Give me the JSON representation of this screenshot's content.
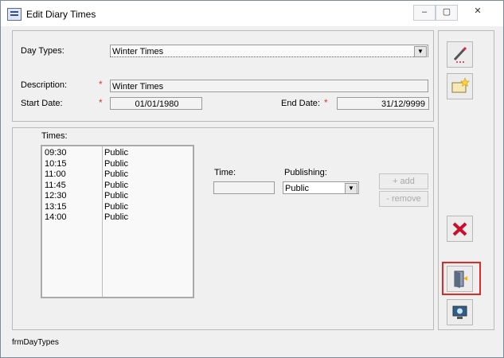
{
  "window": {
    "title": "Edit Diary Times",
    "controls": [
      "–",
      "▢",
      "✕"
    ]
  },
  "form": {
    "day_types_label": "Day Types:",
    "day_types_value": "Winter Times",
    "description_label": "Description:",
    "description_value": "Winter Times",
    "start_date_label": "Start Date:",
    "start_date_value": "01/01/1980",
    "end_date_label": "End Date:",
    "end_date_value": "31/12/9999",
    "required_mark": "*"
  },
  "times": {
    "label": "Times:",
    "rows": [
      {
        "time": "09:30",
        "pub": "Public"
      },
      {
        "time": "10:15",
        "pub": "Public"
      },
      {
        "time": "11:00",
        "pub": "Public"
      },
      {
        "time": "11:45",
        "pub": "Public"
      },
      {
        "time": "12:30",
        "pub": "Public"
      },
      {
        "time": "13:15",
        "pub": "Public"
      },
      {
        "time": "14:00",
        "pub": "Public"
      }
    ],
    "time_label": "Time:",
    "time_value": "",
    "publishing_label": "Publishing:",
    "publishing_value": "Public",
    "add_label": "+ add",
    "remove_label": "- remove"
  },
  "sidebar": {
    "edit_icon": "pencil-icon",
    "new_icon": "new-record-icon",
    "delete_icon": "delete-x-icon",
    "exit_icon": "exit-door-icon",
    "help_icon": "help-monitor-icon",
    "accent": "#e02a2a"
  },
  "status": {
    "form_name": "frmDayTypes"
  }
}
